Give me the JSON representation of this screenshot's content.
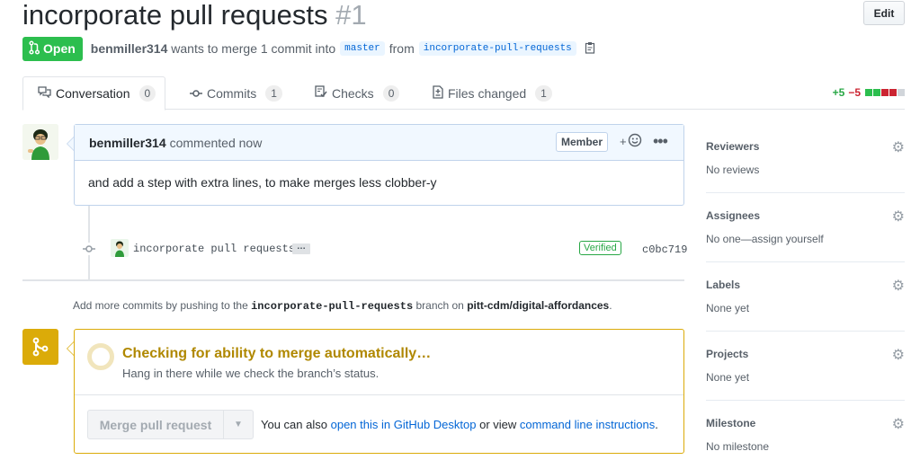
{
  "header": {
    "title": "incorporate pull requests",
    "number": "#1",
    "edit_label": "Edit"
  },
  "meta": {
    "state": "Open",
    "author": "benmiller314",
    "merge_text": "wants to merge 1 commit into",
    "base_branch": "master",
    "from_text": "from",
    "head_branch": "incorporate-pull-requests"
  },
  "tabs": [
    {
      "label": "Conversation",
      "count": "0"
    },
    {
      "label": "Commits",
      "count": "1"
    },
    {
      "label": "Checks",
      "count": "0"
    },
    {
      "label": "Files changed",
      "count": "1"
    }
  ],
  "diffstat": {
    "additions": "+5",
    "deletions": "−5"
  },
  "comment": {
    "author": "benmiller314",
    "action": "commented now",
    "role": "Member",
    "body": "and add a step with extra lines, to make merges less clobber-y"
  },
  "commit": {
    "message": "incorporate pull requests",
    "verified": "Verified",
    "sha": "c0bc719"
  },
  "push_note": {
    "prefix": "Add more commits by pushing to the",
    "branch": "incorporate-pull-requests",
    "middle": "branch on",
    "repo": "pitt-cdm/digital-affordances",
    "suffix": "."
  },
  "merge": {
    "status": "Checking for ability to merge automatically…",
    "sub": "Hang in there while we check the branch’s status.",
    "button": "Merge pull request",
    "also_prefix": "You can also",
    "desktop_link": "open this in GitHub Desktop",
    "also_middle": "or view",
    "cli_link": "command line instructions",
    "also_suffix": "."
  },
  "sidebar": [
    {
      "title": "Reviewers",
      "value": "No reviews"
    },
    {
      "title": "Assignees",
      "value": "No one—assign yourself"
    },
    {
      "title": "Labels",
      "value": "None yet"
    },
    {
      "title": "Projects",
      "value": "None yet"
    },
    {
      "title": "Milestone",
      "value": "No milestone"
    }
  ],
  "colors": {
    "open_green": "#2cbe4e",
    "link_blue": "#0366d6",
    "merge_yellow": "#dbab09",
    "comment_header_bg": "#f1f8ff"
  }
}
